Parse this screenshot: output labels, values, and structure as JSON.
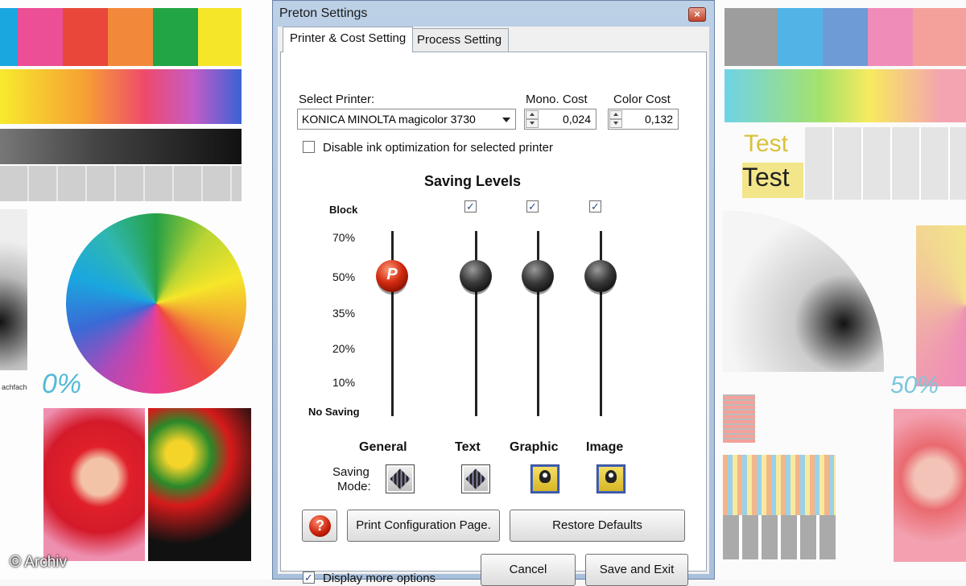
{
  "window": {
    "title": "Preton Settings",
    "close_glyph": "×"
  },
  "tabs": [
    {
      "label": "Printer & Cost Setting",
      "active": true
    },
    {
      "label": "Process Setting",
      "active": false
    }
  ],
  "printer": {
    "select_label": "Select Printer:",
    "selected": "KONICA MINOLTA magicolor 3730",
    "mono_label": "Mono. Cost",
    "mono_value": "0,024",
    "color_label": "Color Cost",
    "color_value": "0,132",
    "disable_ink_label": "Disable ink optimization for selected printer",
    "disable_ink_checked": false
  },
  "saving": {
    "heading": "Saving Levels",
    "block_label": "Block",
    "levels": [
      "70%",
      "50%",
      "35%",
      "20%",
      "10%",
      "No Saving"
    ],
    "channels": [
      {
        "name": "General",
        "level_percent": 50,
        "block": null,
        "mode_icon": "toner-diamond-icon"
      },
      {
        "name": "Text",
        "level_percent": 50,
        "block": true,
        "mode_icon": "toner-diamond-icon"
      },
      {
        "name": "Graphic",
        "level_percent": 50,
        "block": true,
        "mode_icon": "light-bulb-icon"
      },
      {
        "name": "Image",
        "level_percent": 50,
        "block": true,
        "mode_icon": "light-bulb-icon"
      }
    ],
    "mode_label_line1": "Saving",
    "mode_label_line2": "Mode:",
    "logo_glyph": "P"
  },
  "buttons": {
    "help_glyph": "?",
    "print_config": "Print Configuration Page.",
    "restore_defaults": "Restore Defaults",
    "cancel": "Cancel",
    "save_exit": "Save and Exit"
  },
  "display_more": {
    "label": "Display more options",
    "checked": true
  },
  "check_glyph": "✓",
  "background": {
    "left_label_0": "0%",
    "left_caption": "achfach",
    "right_label_50": "50%",
    "right_test_1": "Test",
    "right_test_2": "Test",
    "copyright": "© Archiv"
  },
  "colors": {
    "accent_red": "#d22b10",
    "dialog_frame": "#a9c0dc",
    "bulb_yellow": "#f6e26a"
  }
}
